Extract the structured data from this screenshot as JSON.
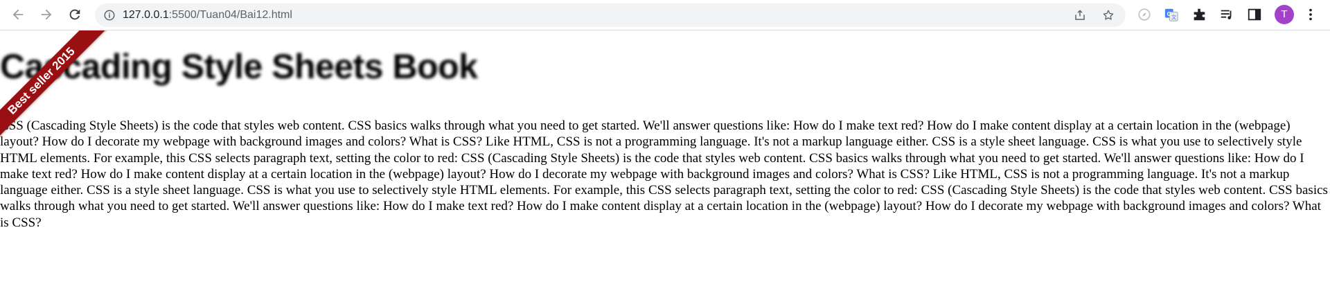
{
  "browser": {
    "url_host": "127.0.0.1",
    "url_rest": ":5500/Tuan04/Bai12.html",
    "avatar_letter": "T",
    "avatar_color": "#a142c9"
  },
  "page": {
    "ribbon_text": "Best seller 2015",
    "ribbon_color": "#9a0f12",
    "heading": "Cascading Style Sheets Book",
    "paragraph": "CSS (Cascading Style Sheets) is the code that styles web content. CSS basics walks through what you need to get started. We'll answer questions like: How do I make text red? How do I make content display at a certain location in the (webpage) layout? How do I decorate my webpage with background images and colors? What is CSS? Like HTML, CSS is not a programming language. It's not a markup language either. CSS is a style sheet language. CSS is what you use to selectively style HTML elements. For example, this CSS selects paragraph text, setting the color to red: CSS (Cascading Style Sheets) is the code that styles web content. CSS basics walks through what you need to get started. We'll answer questions like: How do I make text red? How do I make content display at a certain location in the (webpage) layout? How do I decorate my webpage with background images and colors? What is CSS? Like HTML, CSS is not a programming language. It's not a markup language either. CSS is a style sheet language. CSS is what you use to selectively style HTML elements. For example, this CSS selects paragraph text, setting the color to red: CSS (Cascading Style Sheets) is the code that styles web content. CSS basics walks through what you need to get started. We'll answer questions like: How do I make text red? How do I make content display at a certain location in the (webpage) layout? How do I decorate my webpage with background images and colors? What is CSS?"
  }
}
